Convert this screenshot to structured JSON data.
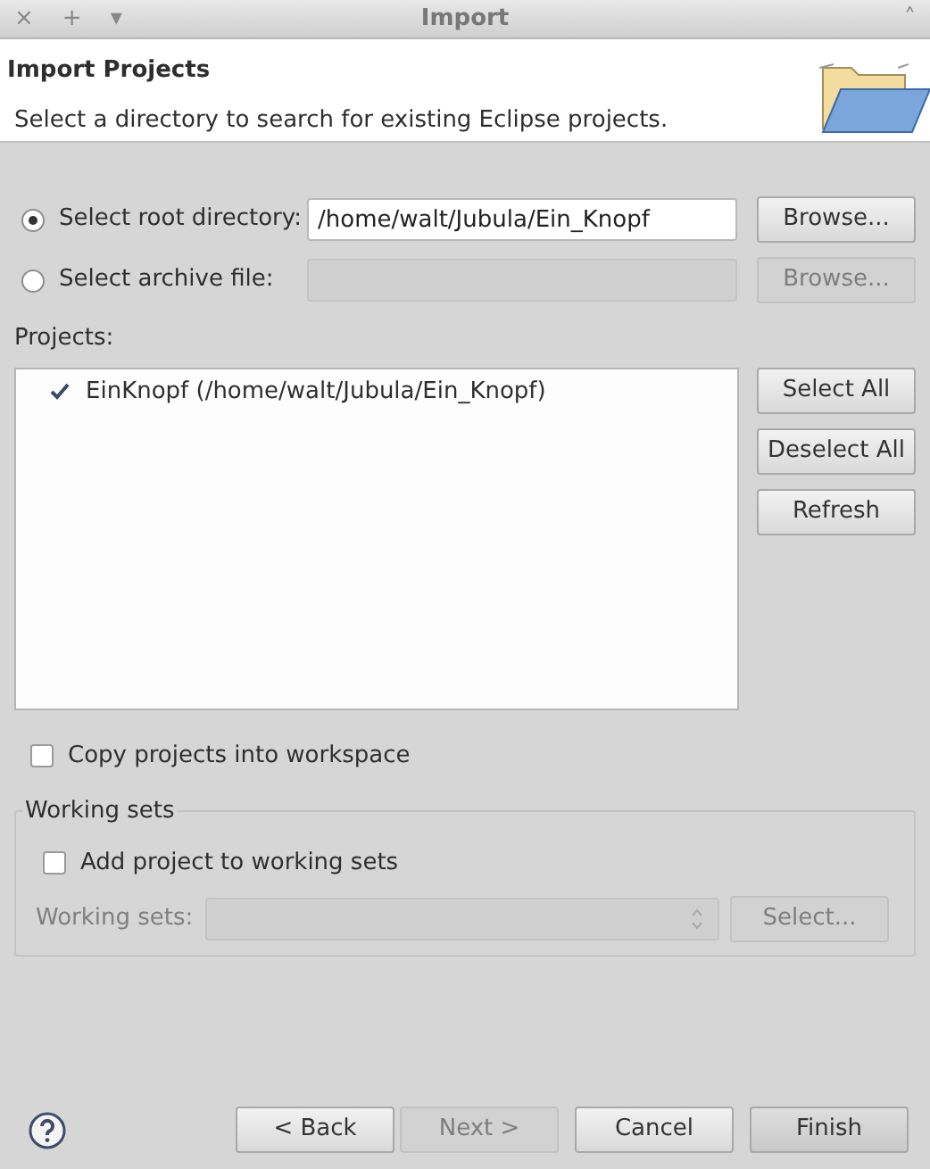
{
  "window": {
    "title": "Import",
    "title_buttons": [
      "×",
      "+",
      "▾"
    ],
    "collapse": "˄"
  },
  "header": {
    "title": "Import Projects",
    "description": "Select a directory to search for existing Eclipse projects."
  },
  "source": [
    {
      "label": "Select root directory:",
      "selected": true,
      "value": "/home/walt/Jubula/Ein_Knopf",
      "disabled": false,
      "browse": "Browse..."
    },
    {
      "label": "Select archive file:",
      "selected": false,
      "disabled": true,
      "browse": "Browse..."
    }
  ],
  "projects": {
    "label": "Projects:",
    "items": [
      {
        "label": "EinKnopf (/home/walt/Jubula/Ein_Knopf)",
        "checked": true
      }
    ],
    "buttons": [
      "Select All",
      "Deselect All",
      "Refresh"
    ]
  },
  "copy_into_workspace": {
    "label": "Copy projects into workspace",
    "checked": false
  },
  "working_sets": {
    "legend": "Working sets",
    "add": {
      "label": "Add project to working sets",
      "checked": false
    },
    "label": "Working sets:",
    "disabled": true,
    "select": "Select..."
  },
  "footer": {
    "buttons": [
      {
        "label": "< Back",
        "disabled": false
      },
      {
        "label": "Next >",
        "disabled": true
      },
      {
        "label": "Cancel",
        "disabled": false
      },
      {
        "label": "Finish",
        "disabled": false
      }
    ]
  }
}
